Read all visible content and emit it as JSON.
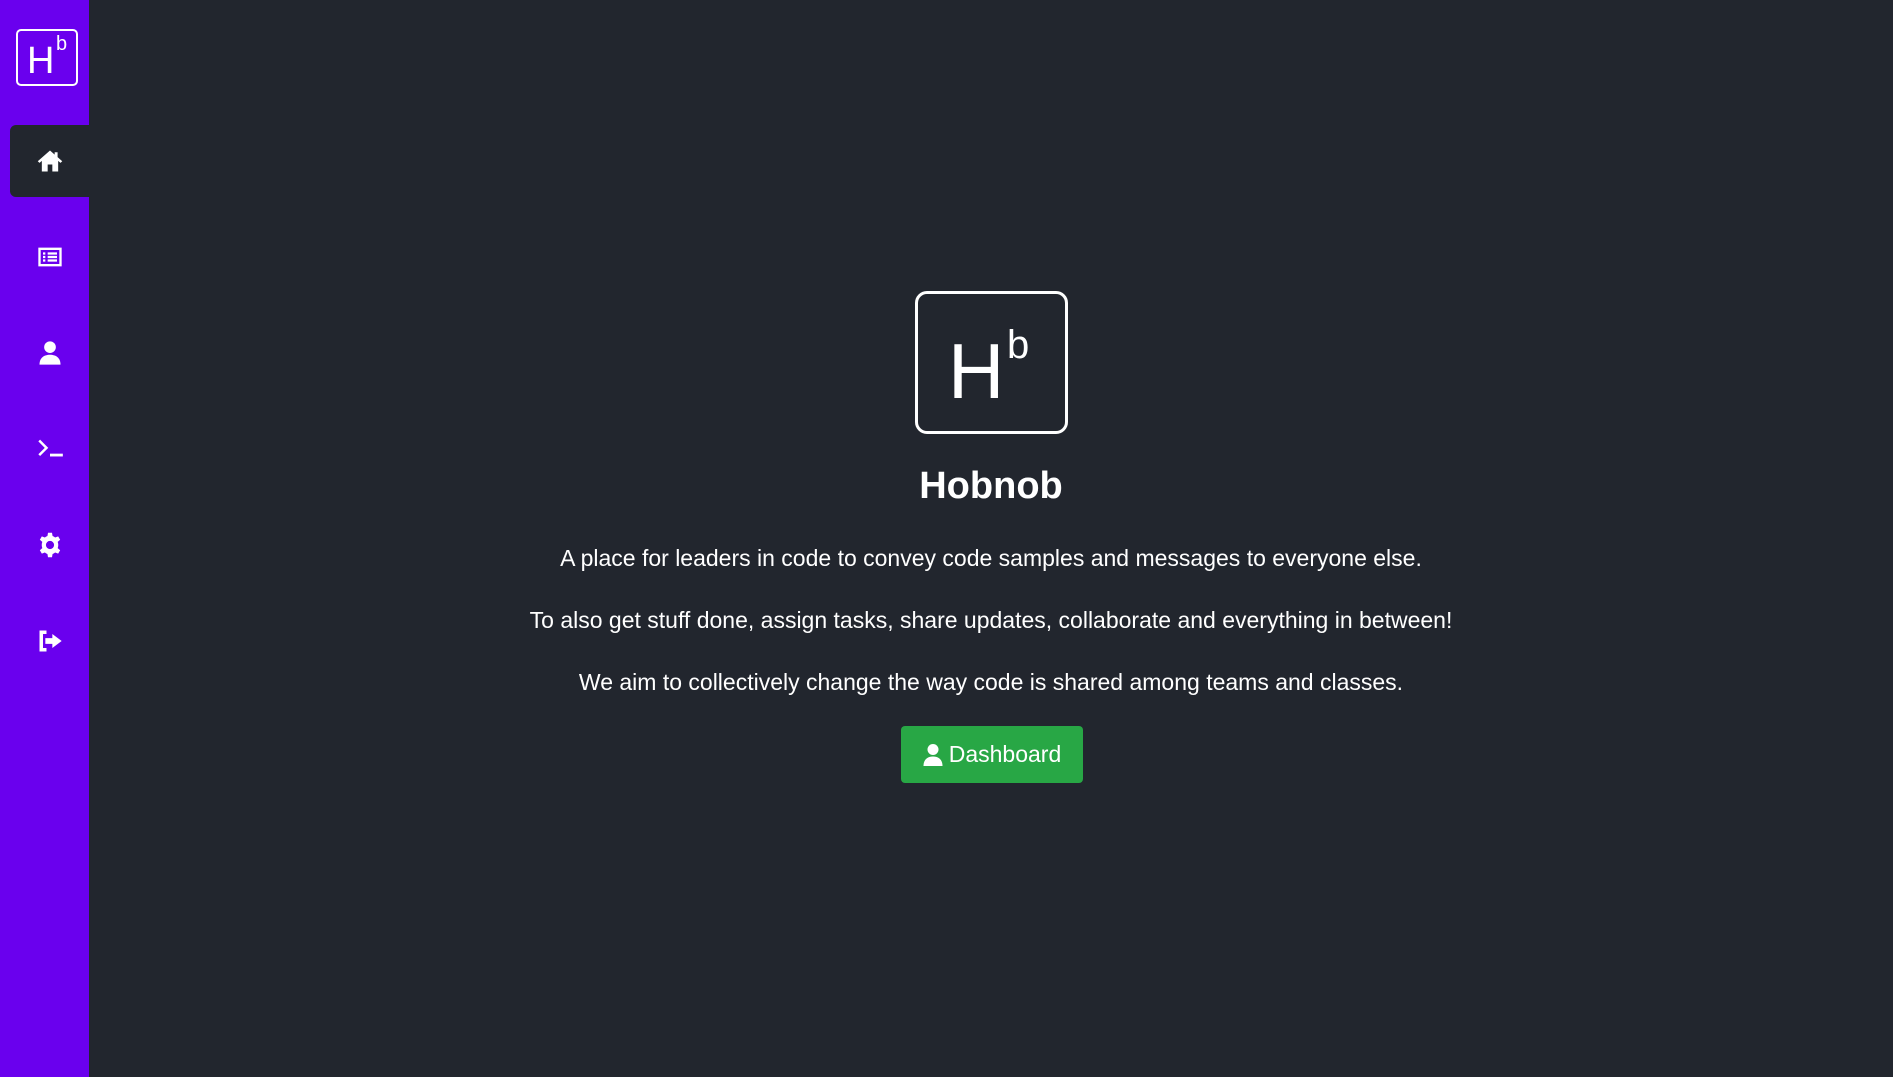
{
  "sidebar": {
    "logo": {
      "main": "H",
      "sup": "b"
    },
    "items": [
      {
        "icon": "home-icon",
        "active": true
      },
      {
        "icon": "list-icon",
        "active": false
      },
      {
        "icon": "user-icon",
        "active": false
      },
      {
        "icon": "terminal-icon",
        "active": false
      },
      {
        "icon": "gear-icon",
        "active": false
      },
      {
        "icon": "sign-out-icon",
        "active": false
      }
    ]
  },
  "main": {
    "logo": {
      "main": "H",
      "sup": "b"
    },
    "title": "Hobnob",
    "lines": [
      "A place for leaders in code to convey code samples and messages to everyone else.",
      "To also get stuff done, assign tasks, share updates, collaborate and everything in between!",
      "We aim to collectively change the way code is shared among teams and classes."
    ],
    "dashboard_button": {
      "label": "Dashboard",
      "icon": "user-icon"
    }
  },
  "colors": {
    "sidebar": "#6a00ee",
    "background": "#22262e",
    "button": "#28a745"
  }
}
